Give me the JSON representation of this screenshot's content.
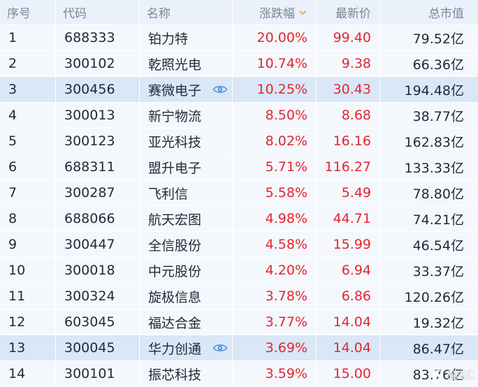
{
  "header": {
    "index": "序号",
    "code": "代码",
    "name": "名称",
    "change": "涨跌幅",
    "price": "最新价",
    "market_cap": "总市值"
  },
  "sort": {
    "column": "change",
    "direction": "desc",
    "icon": "chevron-down-icon",
    "color": "#f0a53a"
  },
  "colors": {
    "up": "#e4252d",
    "text": "#1f2a38",
    "header_text": "#7b8594",
    "highlight_row": "#d9e7f7"
  },
  "rows": [
    {
      "index": "1",
      "code": "688333",
      "name": "铂力特",
      "change": "20.00%",
      "price": "99.40",
      "market_cap": "79.52亿",
      "highlight": false,
      "watch": false
    },
    {
      "index": "2",
      "code": "300102",
      "name": "乾照光电",
      "change": "10.74%",
      "price": "9.38",
      "market_cap": "66.36亿",
      "highlight": false,
      "watch": false
    },
    {
      "index": "3",
      "code": "300456",
      "name": "赛微电子",
      "change": "10.25%",
      "price": "30.43",
      "market_cap": "194.48亿",
      "highlight": true,
      "watch": true
    },
    {
      "index": "4",
      "code": "300013",
      "name": "新宁物流",
      "change": "8.50%",
      "price": "8.68",
      "market_cap": "38.77亿",
      "highlight": false,
      "watch": false
    },
    {
      "index": "5",
      "code": "300123",
      "name": "亚光科技",
      "change": "8.02%",
      "price": "16.16",
      "market_cap": "162.83亿",
      "highlight": false,
      "watch": false
    },
    {
      "index": "6",
      "code": "688311",
      "name": "盟升电子",
      "change": "5.71%",
      "price": "116.27",
      "market_cap": "133.33亿",
      "highlight": false,
      "watch": false
    },
    {
      "index": "7",
      "code": "300287",
      "name": "飞利信",
      "change": "5.58%",
      "price": "5.49",
      "market_cap": "78.80亿",
      "highlight": false,
      "watch": false
    },
    {
      "index": "8",
      "code": "688066",
      "name": "航天宏图",
      "change": "4.98%",
      "price": "44.71",
      "market_cap": "74.21亿",
      "highlight": false,
      "watch": false
    },
    {
      "index": "9",
      "code": "300447",
      "name": "全信股份",
      "change": "4.58%",
      "price": "15.99",
      "market_cap": "46.54亿",
      "highlight": false,
      "watch": false
    },
    {
      "index": "10",
      "code": "300018",
      "name": "中元股份",
      "change": "4.20%",
      "price": "6.94",
      "market_cap": "33.37亿",
      "highlight": false,
      "watch": false
    },
    {
      "index": "11",
      "code": "300324",
      "name": "旋极信息",
      "change": "3.78%",
      "price": "6.86",
      "market_cap": "120.26亿",
      "highlight": false,
      "watch": false
    },
    {
      "index": "12",
      "code": "603045",
      "name": "福达合金",
      "change": "3.77%",
      "price": "14.04",
      "market_cap": "19.32亿",
      "highlight": false,
      "watch": false
    },
    {
      "index": "13",
      "code": "300045",
      "name": "华力创通",
      "change": "3.69%",
      "price": "14.04",
      "market_cap": "86.47亿",
      "highlight": true,
      "watch": true
    },
    {
      "index": "14",
      "code": "300101",
      "name": "振芯科技",
      "change": "3.59%",
      "price": "15.00",
      "market_cap": "83.76亿",
      "highlight": false,
      "watch": false
    }
  ],
  "watermark": {
    "text": "格隆汇",
    "icon": "gelonghui-logo-icon"
  }
}
